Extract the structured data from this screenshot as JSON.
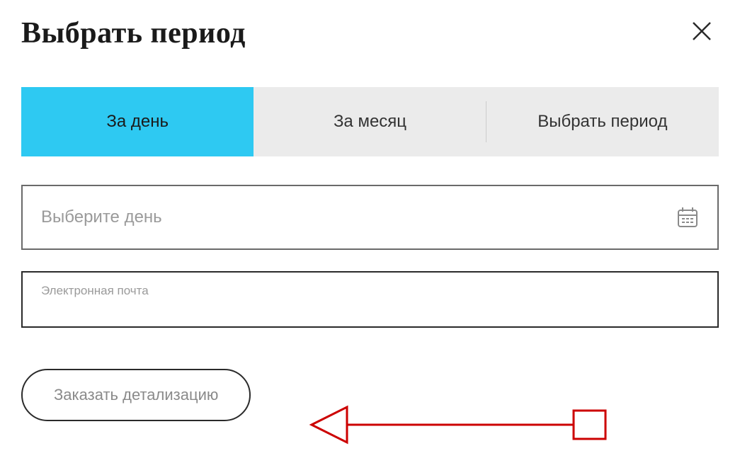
{
  "header": {
    "title": "Выбрать период"
  },
  "tabs": {
    "day": "За день",
    "month": "За месяц",
    "period": "Выбрать период"
  },
  "dateInput": {
    "placeholder": "Выберите день"
  },
  "emailInput": {
    "label": "Электронная почта"
  },
  "submitButton": {
    "label": "Заказать детализацию"
  }
}
